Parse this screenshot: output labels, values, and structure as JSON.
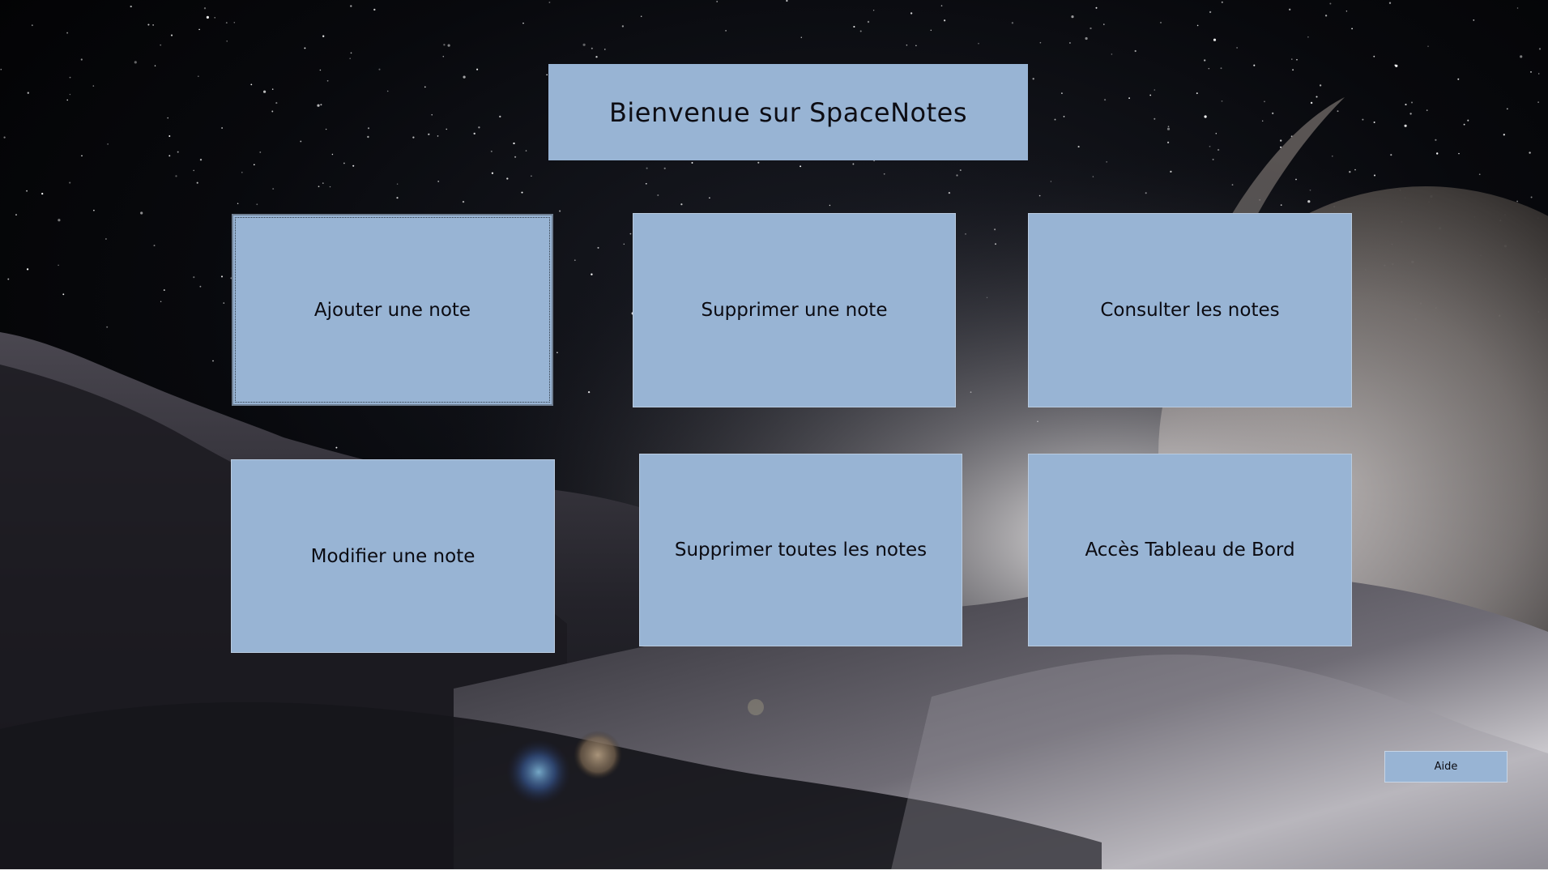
{
  "title": "Bienvenue sur SpaceNotes",
  "menu": {
    "add_note": "Ajouter une note",
    "delete_note": "Supprimer une note",
    "view_notes": "Consulter les notes",
    "edit_note": "Modifier une note",
    "delete_all_notes": "Supprimer toutes les notes",
    "dashboard": "Accès Tableau de Bord"
  },
  "help_button": "Aide",
  "colors": {
    "tile": "#98b4d4",
    "background": "#05060a"
  }
}
